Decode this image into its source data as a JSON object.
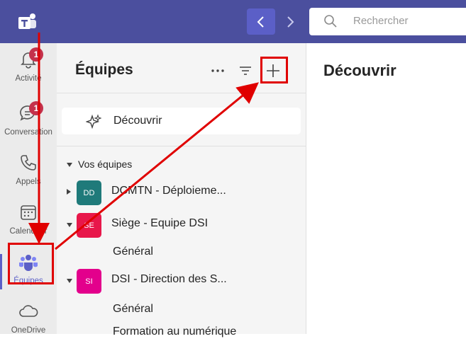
{
  "titlebar": {
    "app_icon": "teams-logo-icon",
    "back_icon": "chevron-left-icon",
    "forward_icon": "chevron-right-icon",
    "search_placeholder": "Rechercher"
  },
  "rail": {
    "items": [
      {
        "label": "Activité",
        "icon": "bell-icon",
        "badge": "1"
      },
      {
        "label": "Conversation",
        "icon": "chat-icon",
        "badge": "1"
      },
      {
        "label": "Appels",
        "icon": "phone-icon"
      },
      {
        "label": "Calendrier",
        "icon": "calendar-icon"
      },
      {
        "label": "Équipes",
        "icon": "teams-icon",
        "active": true
      },
      {
        "label": "OneDrive",
        "icon": "cloud-icon"
      }
    ]
  },
  "panel": {
    "title": "Équipes",
    "more_icon": "more-icon",
    "filter_icon": "filter-icon",
    "add_icon": "plus-icon",
    "discover_label": "Découvrir",
    "section_label": "Vos équipes",
    "teams": [
      {
        "initials": "DD",
        "name": "DCMTN - Déploieme...",
        "color": "#1f7a7a"
      },
      {
        "initials": "SE",
        "name": "Siège - Equipe DSI",
        "color": "#e8174a",
        "channels": [
          "Général"
        ]
      },
      {
        "initials": "SI",
        "name": "DSI - Direction des S...",
        "color": "#e3008c",
        "channels": [
          "Général",
          "Formation au numérique"
        ]
      }
    ]
  },
  "main": {
    "title": "Découvrir"
  },
  "colors": {
    "brand": "#4b4f9e",
    "accent": "#5b5fc7",
    "annotation": "#e00000"
  }
}
